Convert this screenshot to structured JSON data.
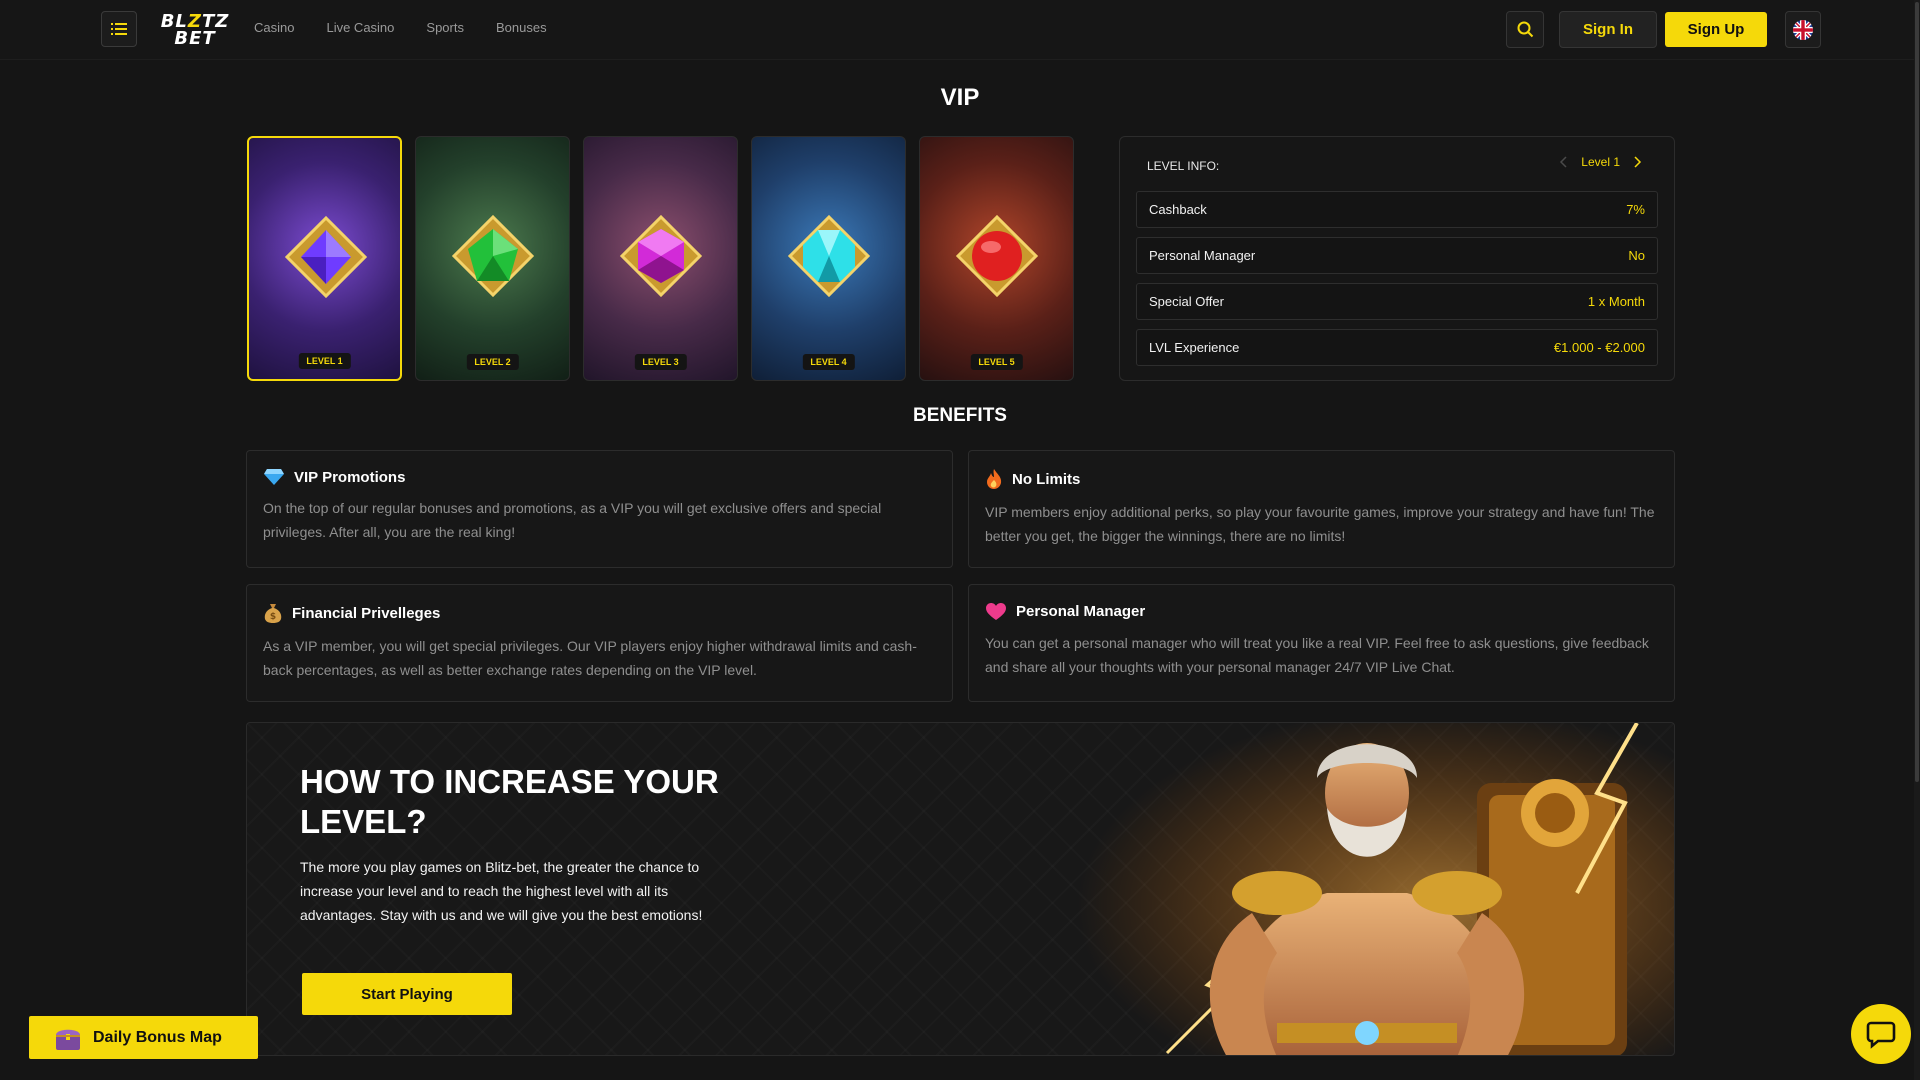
{
  "header": {
    "logo_line1_a": "BL",
    "logo_line1_b": "Z",
    "logo_line1_c": "TZ",
    "logo_line2": "BET",
    "nav": [
      "Casino",
      "Live Casino",
      "Sports",
      "Bonuses"
    ],
    "signin_label": "Sign In",
    "signup_label": "Sign Up",
    "icons": {
      "menu": "menu-list-icon",
      "search": "search-icon",
      "language": "uk-flag-icon"
    }
  },
  "vip": {
    "title": "VIP",
    "levels": [
      {
        "label": "LEVEL 1",
        "gem": "purple-gem",
        "color": "#6f3cff"
      },
      {
        "label": "LEVEL 2",
        "gem": "green-gem",
        "color": "#22c03a"
      },
      {
        "label": "LEVEL 3",
        "gem": "magenta-gem",
        "color": "#d22ad8"
      },
      {
        "label": "LEVEL 4",
        "gem": "cyan-gem",
        "color": "#2ee0e8"
      },
      {
        "label": "LEVEL 5",
        "gem": "red-gem",
        "color": "#e02020"
      }
    ],
    "selected_level": 1
  },
  "level_info": {
    "heading": "LEVEL INFO:",
    "current": "Level 1",
    "rows": [
      {
        "key": "Cashback",
        "value": "7%"
      },
      {
        "key": "Personal Manager",
        "value": "No"
      },
      {
        "key": "Special Offer",
        "value": "1 x Month"
      },
      {
        "key": "LVL Experience",
        "value": "€1.000 - €2.000"
      }
    ]
  },
  "benefits": {
    "title": "BENEFITS",
    "items": [
      {
        "title": "VIP Promotions",
        "icon": "diamond-icon",
        "text": "On the top of our regular bonuses and promotions, as a VIP you will get exclusive offers and special privileges. After all, you are the real king!"
      },
      {
        "title": "No Limits",
        "icon": "fire-icon",
        "text": "VIP members enjoy additional perks, so play your favourite games, improve your strategy and have fun! The better you get, the bigger the winnings, there are no limits!"
      },
      {
        "title": "Financial Privelleges",
        "icon": "money-bag-icon",
        "text": "As a VIP member, you will get special privileges. Our VIP players enjoy higher withdrawal limits and cash-back percentages, as well as better exchange rates depending on the VIP level."
      },
      {
        "title": "Personal Manager",
        "icon": "heart-icon",
        "text": "You can get a personal manager who will treat you like a real VIP. Feel free to ask questions, give feedback and share all your thoughts with your personal manager 24/7 VIP Live Chat."
      }
    ]
  },
  "banner": {
    "title": "HOW TO INCREASE YOUR LEVEL?",
    "text": "The more you play games on Blitz-bet, the greater the chance to increase your level and to reach the highest level with all its advantages. Stay with us and we will give you the best emotions!",
    "cta": "Start Playing"
  },
  "floating": {
    "daily_bonus": "Daily Bonus Map",
    "chat_icon": "chat-bubble-icon"
  },
  "colors": {
    "accent": "#f5d90a",
    "background": "#151515",
    "panel": "#171717"
  }
}
